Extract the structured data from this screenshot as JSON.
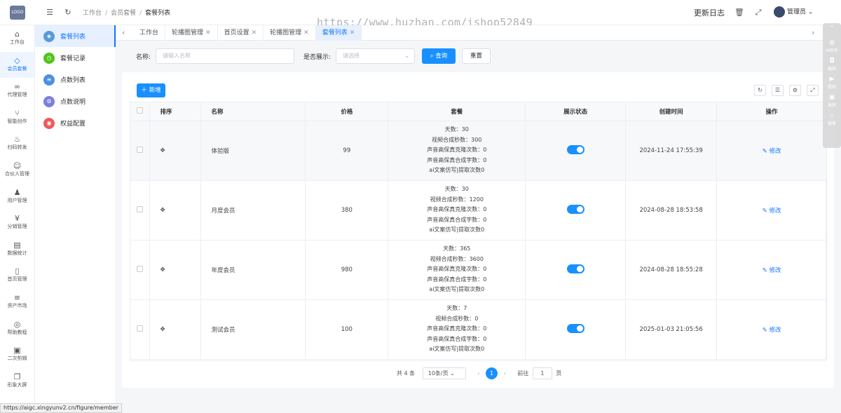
{
  "app": {
    "logo_text": "LOGO"
  },
  "topbar": {
    "breadcrumb": [
      "工作台",
      "会员套餐",
      "套餐列表"
    ],
    "watermark": "https://www.huzhan.com/ishop52849",
    "update_log": "更新日志",
    "user_name": "管理员"
  },
  "rail": [
    {
      "label": "工作台",
      "icon": "home-icon"
    },
    {
      "label": "会员套餐",
      "icon": "diamond-icon"
    },
    {
      "label": "代理管理",
      "icon": "link-icon"
    },
    {
      "label": "智能创作",
      "icon": "branch-icon"
    },
    {
      "label": "扫码转发",
      "icon": "fire-icon"
    },
    {
      "label": "合伙人管理",
      "icon": "handshake-icon"
    },
    {
      "label": "用户管理",
      "icon": "users-icon"
    },
    {
      "label": "分销管理",
      "icon": "yen-icon"
    },
    {
      "label": "数据统计",
      "icon": "chart-icon"
    },
    {
      "label": "首页管理",
      "icon": "phone-icon"
    },
    {
      "label": "资产市场",
      "icon": "database-icon"
    },
    {
      "label": "帮助教程",
      "icon": "help-icon"
    },
    {
      "label": "二次剪辑",
      "icon": "film-icon"
    },
    {
      "label": "形象大屏",
      "icon": "copy-icon"
    }
  ],
  "submenu": [
    {
      "label": "套餐列表",
      "color": "#5b9bd5"
    },
    {
      "label": "套餐记录",
      "color": "#52c41a"
    },
    {
      "label": "点数列表",
      "color": "#4a90e2"
    },
    {
      "label": "点数说明",
      "color": "#7b7fdb"
    },
    {
      "label": "权益配置",
      "color": "#ef5a5a"
    }
  ],
  "tabs": [
    "工作台",
    "轮播图管理",
    "首页设置",
    "轮播图管理",
    "套餐列表"
  ],
  "search": {
    "name_label": "名称:",
    "name_placeholder": "请输入名称",
    "show_label": "是否展示:",
    "show_placeholder": "请选择",
    "query_btn": "查询",
    "reset_btn": "重置"
  },
  "toolbar": {
    "add_btn": "新增"
  },
  "table": {
    "headers": [
      "排序",
      "名称",
      "价格",
      "套餐",
      "展示状态",
      "创建时间",
      "操作"
    ],
    "edit_label": "修改",
    "rows": [
      {
        "name": "体验版",
        "price": "99",
        "package": [
          "天数：30",
          "视频合成秒数：300",
          "声音高保真克隆次数：0",
          "声音高保真合成字数：0",
          "ai文案仿写|提取次数0"
        ],
        "created": "2024-11-24 17:55:39"
      },
      {
        "name": "月度会员",
        "price": "380",
        "package": [
          "天数：30",
          "视频合成秒数：1200",
          "声音高保真克隆次数：0",
          "声音高保真合成字数：0",
          "ai文案仿写|提取次数0"
        ],
        "created": "2024-08-28 18:53:58"
      },
      {
        "name": "年度会员",
        "price": "980",
        "package": [
          "天数：365",
          "视频合成秒数：3600",
          "声音高保真克隆次数：0",
          "声音高保真合成字数：0",
          "ai文案仿写|提取次数0"
        ],
        "created": "2024-08-28 18:55:28"
      },
      {
        "name": "测试会员",
        "price": "100",
        "package": [
          "天数：7",
          "视频合成秒数：0",
          "声音高保真克隆次数：0",
          "声音高保真合成字数：0",
          "ai文案仿写|提取次数0"
        ],
        "created": "2025-01-03 21:05:56"
      }
    ]
  },
  "pager": {
    "total": "共 4 条",
    "page_size": "10条/页",
    "current": "1",
    "goto_label": "前往",
    "goto_value": "1",
    "page_unit": "页"
  },
  "float_tools": [
    "AI助手",
    "截图",
    "视频",
    "录屏",
    "搜索"
  ],
  "status_url": "https://aigc.xingyunv2.cn/figure/member"
}
